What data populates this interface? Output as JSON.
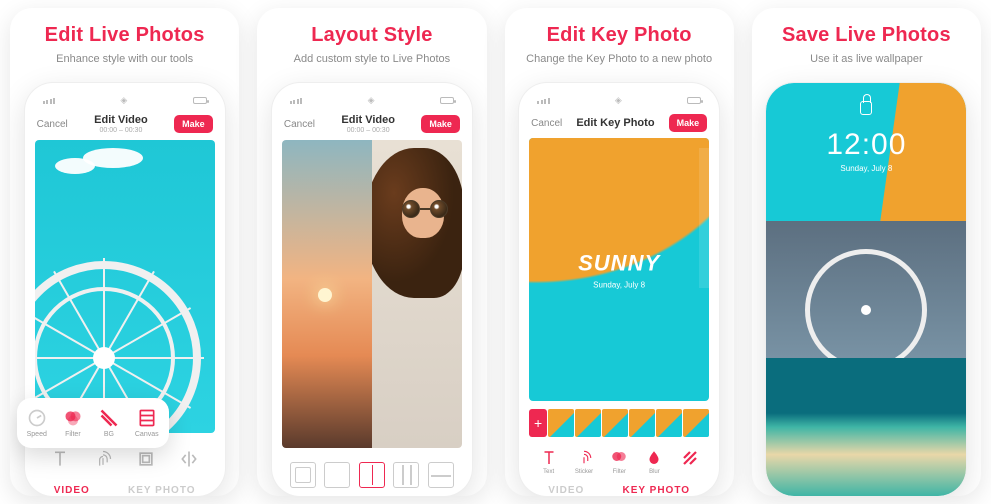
{
  "panels": [
    {
      "headline": "Edit Live Photos",
      "subhead": "Enhance style with our tools",
      "nav": {
        "cancel": "Cancel",
        "title": "Edit Video",
        "time": "00:00 – 00:30",
        "make": "Make"
      },
      "popup_tools": [
        {
          "label": "Speed"
        },
        {
          "label": "Filter"
        },
        {
          "label": "BG"
        },
        {
          "label": "Canvas"
        }
      ],
      "tabs": {
        "video": "VIDEO",
        "key": "KEY PHOTO"
      }
    },
    {
      "headline": "Layout Style",
      "subhead": "Add custom style to Live Photos",
      "nav": {
        "cancel": "Cancel",
        "title": "Edit Video",
        "time": "00:00 – 00:30",
        "make": "Make"
      }
    },
    {
      "headline": "Edit Key Photo",
      "subhead": "Change the Key Photo to a new photo",
      "nav": {
        "cancel": "Cancel",
        "title": "Edit Key Photo",
        "make": "Make"
      },
      "overlay": {
        "big": "SUNNY",
        "small": "Sunday, July 8"
      },
      "tools": [
        {
          "label": "Text"
        },
        {
          "label": "Sticker"
        },
        {
          "label": "Filter"
        },
        {
          "label": "Blur"
        }
      ],
      "tabs": {
        "video": "VIDEO",
        "key": "KEY PHOTO"
      }
    },
    {
      "headline": "Save Live Photos",
      "subhead": "Use it as live wallpaper",
      "lock": {
        "time": "12:00",
        "date": "Sunday, July 8"
      }
    }
  ]
}
